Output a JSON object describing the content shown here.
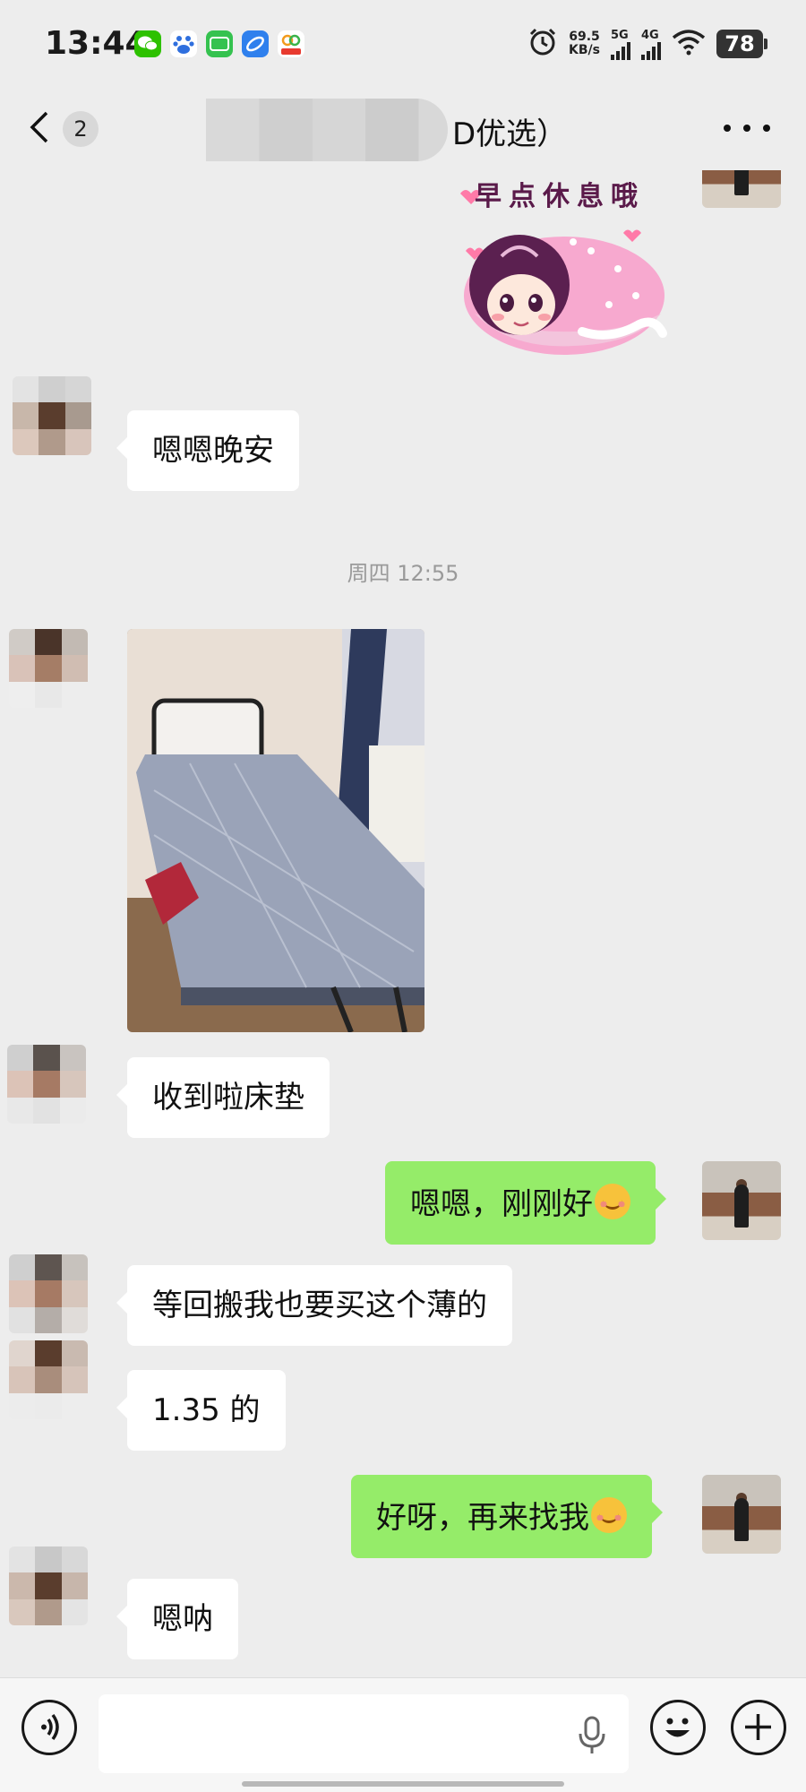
{
  "status_bar": {
    "time": "13:44",
    "net_speed_value": "69.5",
    "net_speed_unit": "KB/s",
    "signal_1_label": "5G",
    "signal_2_label": "4G",
    "battery": "78",
    "app_icons": [
      "wechat-icon",
      "baidu-icon",
      "iqiyi-icon",
      "browser-icon",
      "58-icon"
    ]
  },
  "nav": {
    "unread_count": "2",
    "title_visible": "D优选）"
  },
  "sticker": {
    "caption": "早点休息哦"
  },
  "messages": [
    {
      "side": "left",
      "text": "嗯嗯晚安"
    },
    {
      "side": "left",
      "text": "收到啦床垫"
    },
    {
      "side": "right",
      "text": "嗯嗯，刚刚好"
    },
    {
      "side": "left",
      "text": "等回搬我也要买这个薄的"
    },
    {
      "side": "left",
      "text": "1.35 的"
    },
    {
      "side": "right",
      "text": "好呀，再来找我"
    },
    {
      "side": "left",
      "text": "嗯呐"
    }
  ],
  "timestamp": "周四 12:55",
  "colors": {
    "background": "#ededed",
    "bubble_self": "#95ec69",
    "bubble_other": "#ffffff",
    "timestamp_text": "#9a9a9a"
  }
}
